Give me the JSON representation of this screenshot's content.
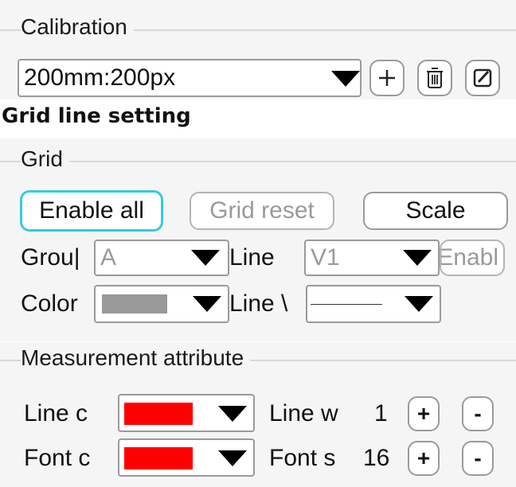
{
  "calibration": {
    "title": "Calibration",
    "selected": "200mm:200px",
    "add_icon": "plus-icon",
    "delete_icon": "trash-icon",
    "edit_icon": "edit-icon"
  },
  "heading": "Grid line setting",
  "grid": {
    "title": "Grid",
    "enable_all": "Enable all",
    "grid_reset": "Grid reset",
    "scale": "Scale",
    "group_label": "Grou|",
    "group_value": "A",
    "line_label": "Line",
    "line_value": "V1",
    "enable_label": "Enabl",
    "color_label": "Color",
    "color_value": "#999999",
    "line_width_label": "Line \\"
  },
  "measurement": {
    "title": "Measurement attribute",
    "line_color_label": "Line c",
    "line_color_value": "#ff0000",
    "line_width_label": "Line w",
    "line_width_value": "1",
    "font_color_label": "Font c",
    "font_color_value": "#ff0000",
    "font_size_label": "Font s",
    "font_size_value": "16",
    "plus": "+",
    "minus": "-"
  },
  "colors": {
    "focus": "#33ccdd",
    "border": "#9a9a9a"
  }
}
